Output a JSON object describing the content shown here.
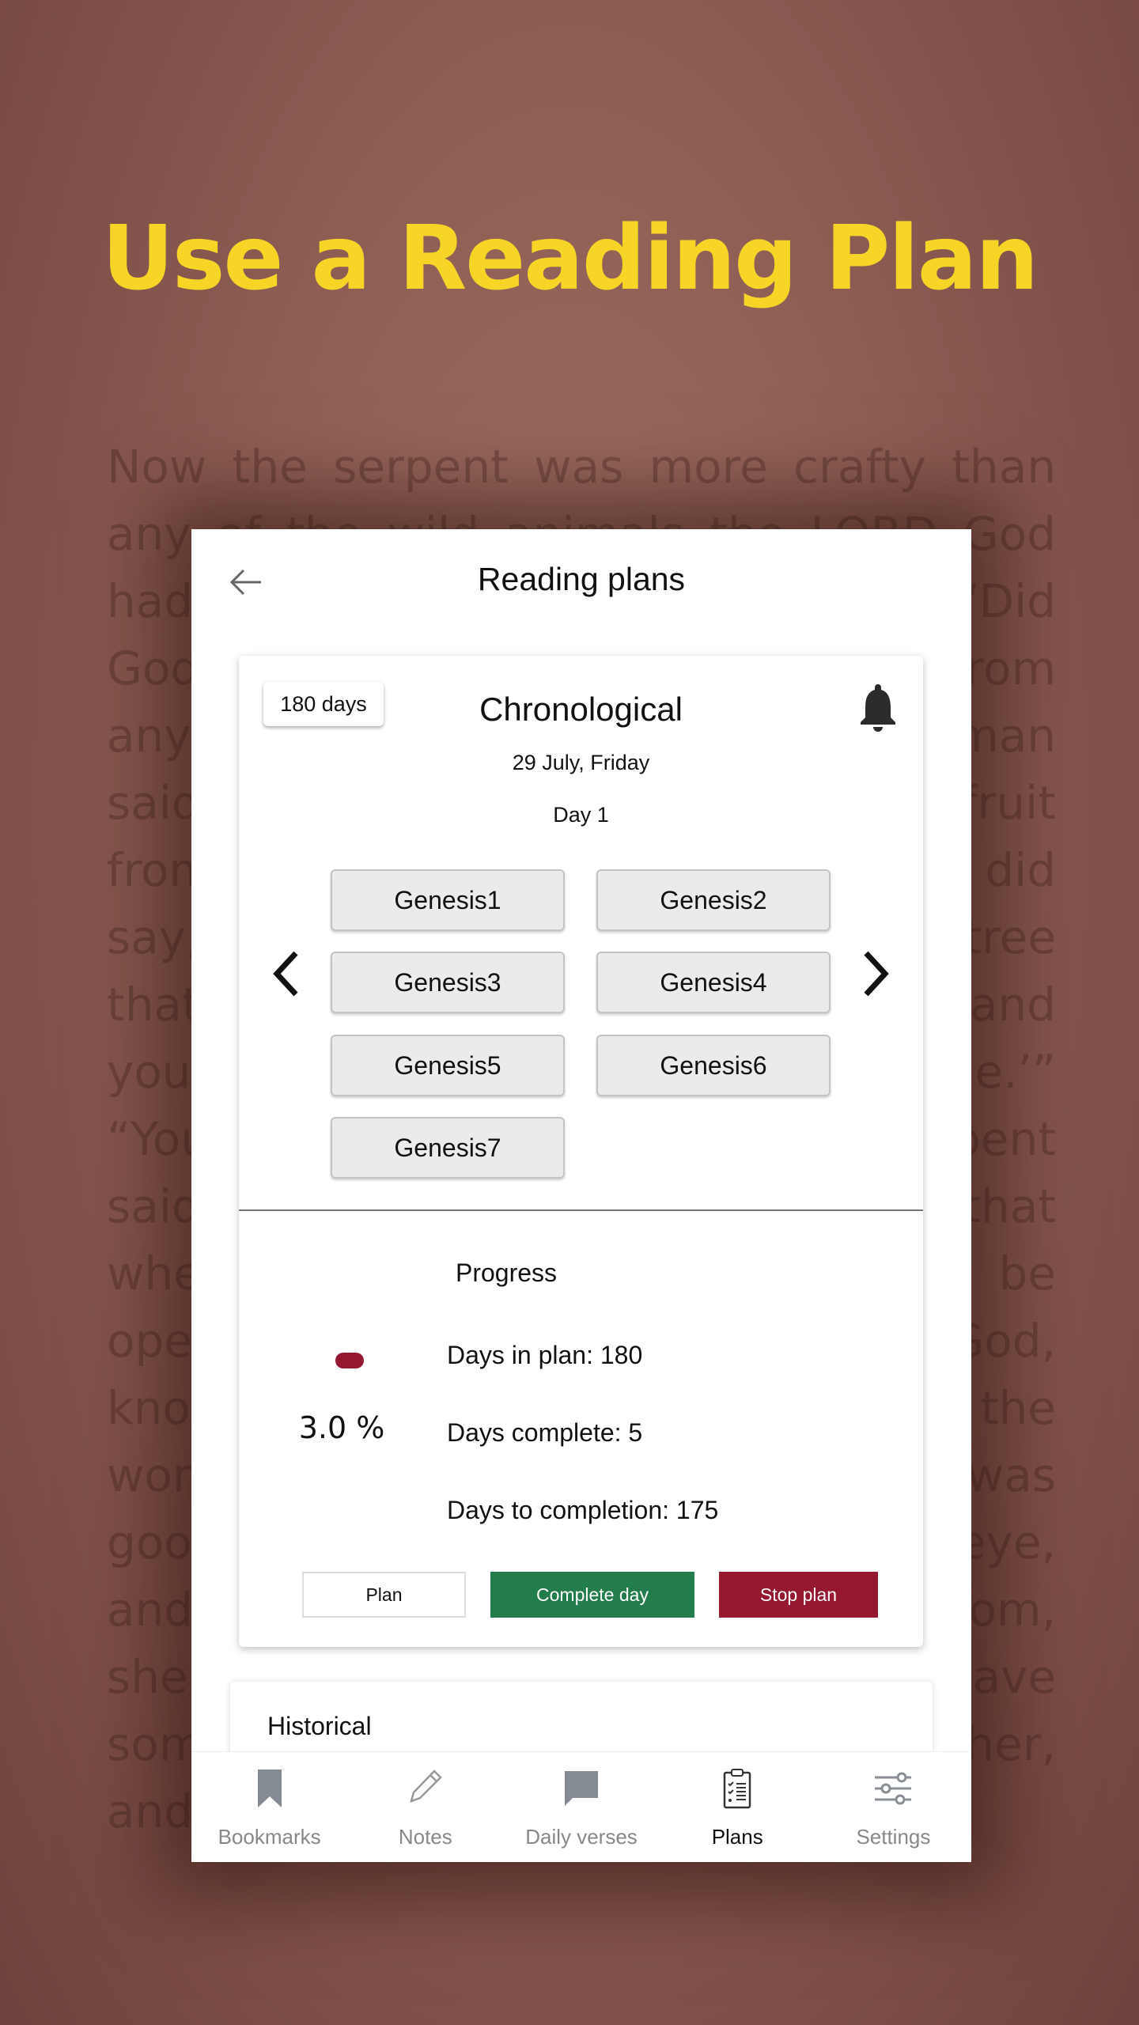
{
  "headline": "Use a Reading Plan",
  "background_text": "Now the serpent was more crafty than any of the wild animals the LORD God had made. He said to the woman, “Did God really say, ‘You must not eat from any tree in the garden’?” The woman said to the serpent, “We may eat fruit from the trees in the garden, but God did say, ‘You must not eat fruit from the tree that is in the middle of the garden, and you must not touch it, or you will die.’” “You will not certainly die,” the serpent said to the woman. “For God knows that when you eat from it your eyes will be opened, and you will be like God, knowing good and evil.” When the woman saw that the fruit of the tree was good for food and pleasing to the eye, and also desirable for gaining wisdom, she took some and ate it. She also gave some to her husband, who was with her, and he ate it.",
  "header": {
    "title": "Reading plans",
    "back_icon": "arrow-left-icon"
  },
  "plan": {
    "duration_badge": "180 days",
    "name": "Chronological",
    "date": "29 July, Friday",
    "day": "Day 1",
    "readings": [
      "Genesis1",
      "Genesis2",
      "Genesis3",
      "Genesis4",
      "Genesis5",
      "Genesis6",
      "Genesis7"
    ],
    "progress": {
      "title": "Progress",
      "percent_label": "3.0 %",
      "percent": 3.0,
      "days_in_plan": "Days in plan: 180",
      "days_complete": "Days complete:  5",
      "days_to_completion": "Days to completion:  175"
    },
    "buttons": {
      "plan": "Plan",
      "complete": "Complete day",
      "stop": "Stop plan"
    }
  },
  "historical": {
    "title": "Historical"
  },
  "nav": [
    {
      "label": "Bookmarks",
      "icon": "bookmark-icon"
    },
    {
      "label": "Notes",
      "icon": "pencil-icon"
    },
    {
      "label": "Daily verses",
      "icon": "chat-icon"
    },
    {
      "label": "Plans",
      "icon": "clipboard-icon",
      "active": true
    },
    {
      "label": "Settings",
      "icon": "sliders-icon"
    }
  ],
  "colors": {
    "headline": "#f7d527",
    "complete": "#237c4b",
    "stop": "#951730",
    "progress_dot": "#951730"
  }
}
